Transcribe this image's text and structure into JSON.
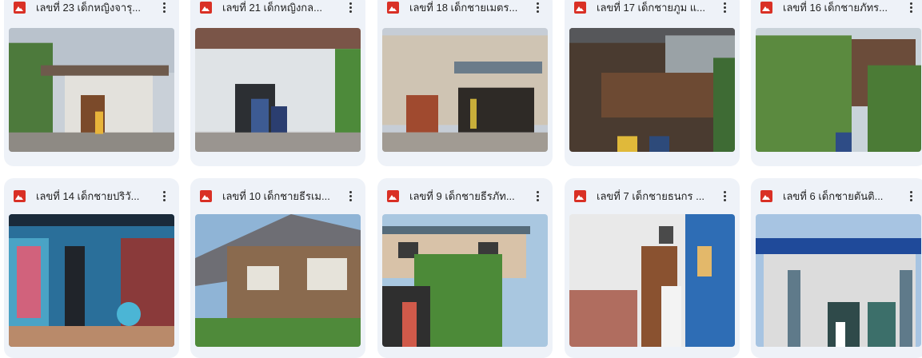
{
  "files": [
    {
      "name": "เลขที่ 23 เด็กหญิงจารุ..."
    },
    {
      "name": "เลขที่ 21 เด็กหญิงกล..."
    },
    {
      "name": "เลขที่ 18 เด็กชายเมตร..."
    },
    {
      "name": "เลขที่ 17 เด็กชายภูม แ..."
    },
    {
      "name": "เลขที่ 16 เด็กชายภัทร..."
    },
    {
      "name": "เลขที่ 14 เด็กชายปริวั..."
    },
    {
      "name": "เลขที่ 10 เด็กชายธีรเม..."
    },
    {
      "name": "เลขที่ 9 เด็กชายธีรภัท..."
    },
    {
      "name": "เลขที่ 7 เด็กชายธนกร ..."
    },
    {
      "name": "เลขที่ 6 เด็กชายตันติ..."
    }
  ],
  "icons": {
    "file_type": "image-file-icon",
    "menu": "more-vert-icon"
  },
  "colors": {
    "card_bg": "#eef2f8",
    "image_icon": "#d93025",
    "text": "#1f1f1f"
  }
}
